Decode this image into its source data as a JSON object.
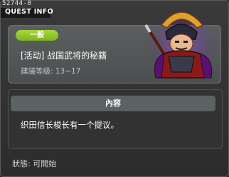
{
  "window": {
    "quest_id": "52744-0",
    "title": "QUEST INFO"
  },
  "quest": {
    "category": "一般",
    "name": "[活动] 战国武将的秘籍",
    "level": "建議等級: 13~17"
  },
  "content": {
    "header": "內容",
    "text": "织田信长梭长有一个提议。"
  },
  "status": {
    "text": "狀態: 可開始"
  },
  "colors": {
    "badge": "#8fc22a",
    "panel": "#525656",
    "background": "#2c2c2c"
  },
  "icons": {
    "npc": "samurai-warlord-portrait"
  }
}
